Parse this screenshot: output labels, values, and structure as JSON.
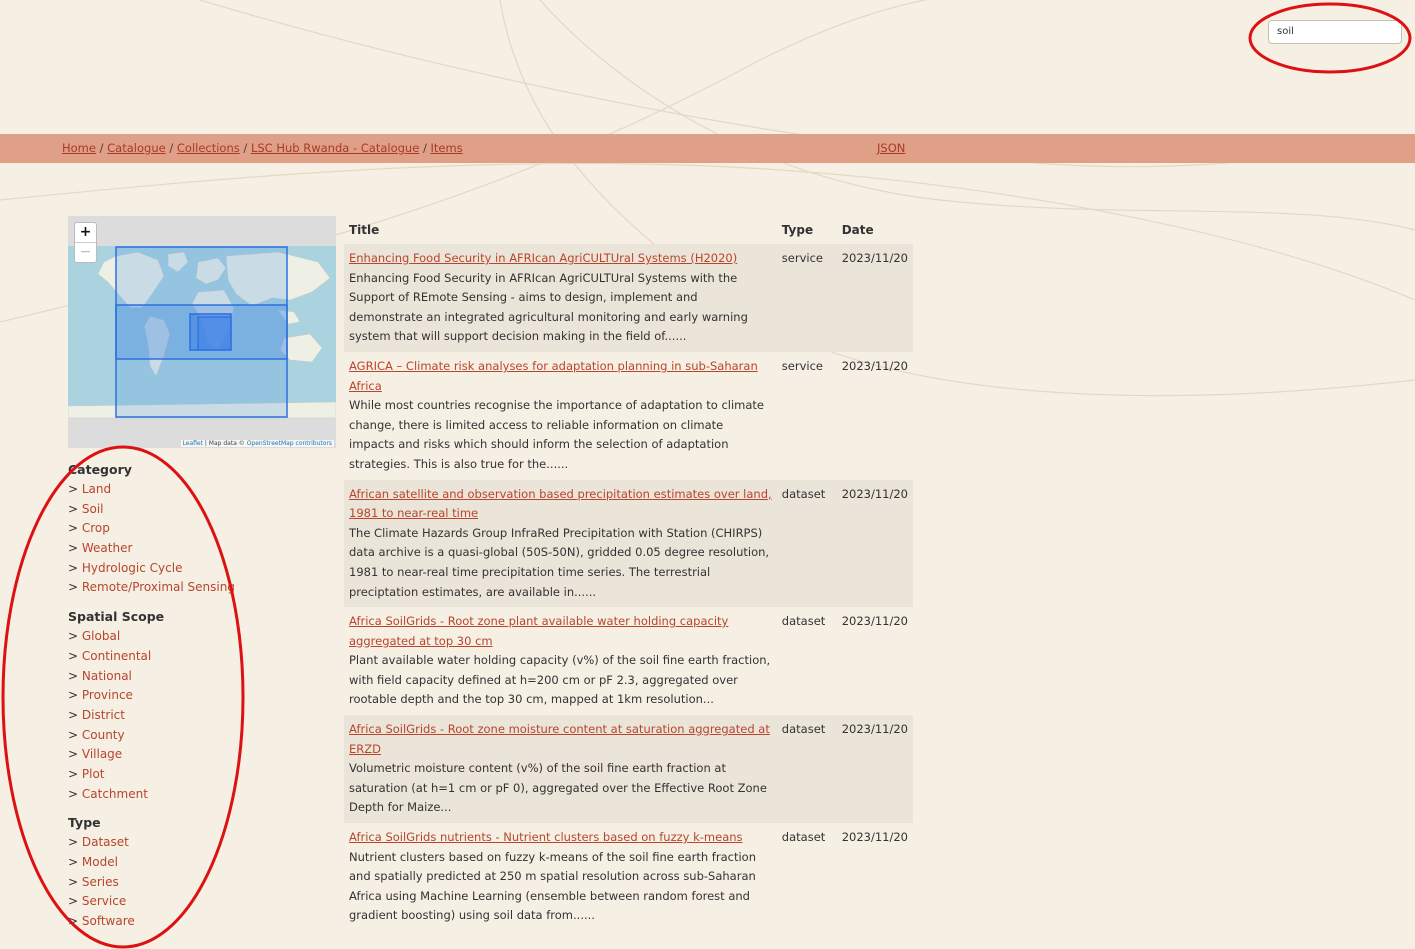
{
  "search": {
    "value": "soil"
  },
  "breadcrumb": {
    "items": [
      "Home",
      "Catalogue",
      "Collections",
      "LSC Hub Rwanda - Catalogue",
      "Items"
    ],
    "separator": " / ",
    "json_label": "JSON"
  },
  "map": {
    "zoom_in": "+",
    "zoom_out": "−",
    "attribution_link1": "Leaflet",
    "attribution_mid": " | Map data © ",
    "attribution_link2": "OpenStreetMap contributors"
  },
  "facets": [
    {
      "heading": "Category",
      "items": [
        "Land",
        "Soil",
        "Crop",
        "Weather",
        "Hydrologic Cycle",
        "Remote/Proximal Sensing"
      ]
    },
    {
      "heading": "Spatial Scope",
      "items": [
        "Global",
        "Continental",
        "National",
        "Province",
        "District",
        "County",
        "Village",
        "Plot",
        "Catchment"
      ]
    },
    {
      "heading": "Type",
      "items": [
        "Dataset",
        "Model",
        "Series",
        "Service",
        "Software"
      ]
    }
  ],
  "table": {
    "headers": {
      "title": "Title",
      "type": "Type",
      "date": "Date"
    },
    "rows": [
      {
        "title": "Enhancing Food Security in AFRIcan AgriCULTUral Systems (H2020)",
        "desc": "Enhancing Food Security in AFRIcan AgriCULTUral Systems with the Support of REmote Sensing - aims to design, implement and demonstrate an integrated agricultural monitoring and early warning system that will support decision making in the field of......",
        "type": "service",
        "date": "2023/11/20"
      },
      {
        "title": "AGRICA – Climate risk analyses for adaptation planning in sub-Saharan Africa",
        "desc": "While most countries recognise the importance of adaptation to climate change, there is limited access to reliable information on climate impacts and risks which should inform the selection of adaptation strategies. This is also true for the......",
        "type": "service",
        "date": "2023/11/20"
      },
      {
        "title": "African satellite and observation based precipitation estimates over land, 1981 to near-real time",
        "desc": "The Climate Hazards Group InfraRed Precipitation with Station (CHIRPS) data archive is a quasi-global (50S-50N), gridded 0.05 degree resolution, 1981 to near-real time precipitation time series. The terrestrial preciptation estimates, are available in......",
        "type": "dataset",
        "date": "2023/11/20"
      },
      {
        "title": "Africa SoilGrids - Root zone plant available water holding capacity aggregated at top 30 cm",
        "desc": "Plant available water holding capacity (v%) of the soil fine earth fraction, with field capacity defined at h=200 cm or pF 2.3, aggregated over rootable depth and the top 30 cm, mapped at 1km resolution...",
        "type": "dataset",
        "date": "2023/11/20"
      },
      {
        "title": "Africa SoilGrids - Root zone moisture content at saturation aggregated at ERZD",
        "desc": "Volumetric moisture content (v%) of the soil fine earth fraction at saturation (at h=1 cm or pF 0), aggregated over the Effective Root Zone Depth for Maize...",
        "type": "dataset",
        "date": "2023/11/20"
      },
      {
        "title": "Africa SoilGrids nutrients - Nutrient clusters based on fuzzy k-means",
        "desc": "Nutrient clusters based on fuzzy k-means of the soil fine earth fraction and spatially predicted at 250 m spatial resolution across sub-Saharan Africa using Machine Learning (ensemble between random forest and gradient boosting) using soil data from......",
        "type": "dataset",
        "date": "2023/11/20"
      }
    ]
  },
  "colors": {
    "accent": "#b8452c",
    "crumb_bar": "#e0a088",
    "background": "#f5efe4",
    "annotation": "#dd1111"
  }
}
